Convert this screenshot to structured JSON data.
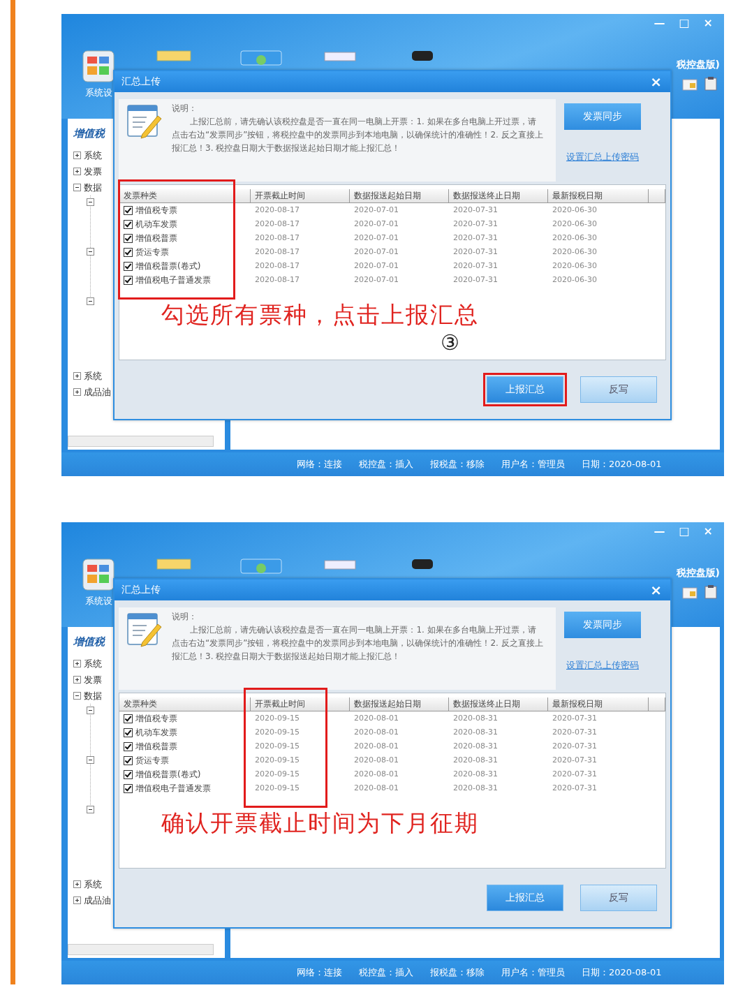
{
  "screens": [
    {
      "window": {
        "title_fragment": "税控盘版)",
        "controls": [
          "—",
          "□",
          "×"
        ],
        "toolbar_label": "系统设",
        "sidebar": {
          "title": "增值税",
          "items": [
            {
              "label": "系统",
              "expanded": false
            },
            {
              "label": "发票",
              "expanded": false
            },
            {
              "label": "数据",
              "expanded": true,
              "children": [
                {
                  "expanded": true
                },
                {
                  "expanded": true
                },
                {
                  "expanded": true
                }
              ]
            },
            {
              "label": "系统",
              "expanded": false
            },
            {
              "label": "成品油",
              "expanded": false
            }
          ]
        },
        "status_bar": [
          "网络：连接",
          "税控盘：插入",
          "报税盘：移除",
          "用户名：管理员",
          "日期：2020-08-01"
        ]
      },
      "dialog": {
        "title": "汇总上传",
        "close": "×",
        "note_label": "说明：",
        "note": "上报汇总前，请先确认该税控盘是否一直在同一电脑上开票：1. 如果在多台电脑上开过票，请点击右边“发票同步”按钮，将税控盘中的发票同步到本地电脑，以确保统计的准确性！2. 反之直接上报汇总！3. 税控盘日期大于数据报送起始日期才能上报汇总！",
        "sync_button": "发票同步",
        "password_link": "设置汇总上传密码",
        "table": {
          "columns": [
            {
              "label": "发票种类",
              "highlighted": true
            },
            {
              "label": "开票截止时间",
              "highlighted": false
            },
            {
              "label": "数据报送起始日期",
              "highlighted": false
            },
            {
              "label": "数据报送终止日期",
              "highlighted": false
            },
            {
              "label": "最新报税日期",
              "highlighted": false
            }
          ],
          "rows": [
            {
              "checked": true,
              "cells": [
                "增值税专票",
                "2020-08-17",
                "2020-07-01",
                "2020-07-31",
                "2020-06-30"
              ]
            },
            {
              "checked": true,
              "cells": [
                "机动车发票",
                "2020-08-17",
                "2020-07-01",
                "2020-07-31",
                "2020-06-30"
              ]
            },
            {
              "checked": true,
              "cells": [
                "增值税普票",
                "2020-08-17",
                "2020-07-01",
                "2020-07-31",
                "2020-06-30"
              ]
            },
            {
              "checked": true,
              "cells": [
                "货运专票",
                "2020-08-17",
                "2020-07-01",
                "2020-07-31",
                "2020-06-30"
              ]
            },
            {
              "checked": true,
              "cells": [
                "增值税普票(卷式)",
                "2020-08-17",
                "2020-07-01",
                "2020-07-31",
                "2020-06-30"
              ]
            },
            {
              "checked": true,
              "cells": [
                "增值税电子普通发票",
                "2020-08-17",
                "2020-07-01",
                "2020-07-31",
                "2020-06-30"
              ]
            }
          ]
        },
        "annotation": {
          "text": "勾选所有票种，点击上报汇总",
          "step": "③"
        },
        "buttons": [
          {
            "label": "上报汇总",
            "highlighted": true
          },
          {
            "label": "反写",
            "highlighted": false
          }
        ]
      }
    },
    {
      "window": {
        "title_fragment": "税控盘版)",
        "controls": [
          "—",
          "□",
          "×"
        ],
        "toolbar_label": "系统设",
        "sidebar": {
          "title": "增值税",
          "items": [
            {
              "label": "系统",
              "expanded": false
            },
            {
              "label": "发票",
              "expanded": false
            },
            {
              "label": "数据",
              "expanded": true,
              "children": [
                {
                  "expanded": true
                },
                {
                  "expanded": true
                },
                {
                  "expanded": true
                }
              ]
            },
            {
              "label": "系统",
              "expanded": false
            },
            {
              "label": "成品油",
              "expanded": false
            }
          ]
        },
        "status_bar": [
          "网络：连接",
          "税控盘：插入",
          "报税盘：移除",
          "用户名：管理员",
          "日期：2020-08-01"
        ]
      },
      "dialog": {
        "title": "汇总上传",
        "close": "×",
        "note_label": "说明：",
        "note": "上报汇总前，请先确认该税控盘是否一直在同一电脑上开票：1. 如果在多台电脑上开过票，请点击右边“发票同步”按钮，将税控盘中的发票同步到本地电脑，以确保统计的准确性！2. 反之直接上报汇总！3. 税控盘日期大于数据报送起始日期才能上报汇总！",
        "sync_button": "发票同步",
        "password_link": "设置汇总上传密码",
        "table": {
          "columns": [
            {
              "label": "发票种类",
              "highlighted": false
            },
            {
              "label": "开票截止时间",
              "highlighted": true
            },
            {
              "label": "数据报送起始日期",
              "highlighted": false
            },
            {
              "label": "数据报送终止日期",
              "highlighted": false
            },
            {
              "label": "最新报税日期",
              "highlighted": false
            }
          ],
          "rows": [
            {
              "checked": true,
              "cells": [
                "增值税专票",
                "2020-09-15",
                "2020-08-01",
                "2020-08-31",
                "2020-07-31"
              ]
            },
            {
              "checked": true,
              "cells": [
                "机动车发票",
                "2020-09-15",
                "2020-08-01",
                "2020-08-31",
                "2020-07-31"
              ]
            },
            {
              "checked": true,
              "cells": [
                "增值税普票",
                "2020-09-15",
                "2020-08-01",
                "2020-08-31",
                "2020-07-31"
              ]
            },
            {
              "checked": true,
              "cells": [
                "货运专票",
                "2020-09-15",
                "2020-08-01",
                "2020-08-31",
                "2020-07-31"
              ]
            },
            {
              "checked": true,
              "cells": [
                "增值税普票(卷式)",
                "2020-09-15",
                "2020-08-01",
                "2020-08-31",
                "2020-07-31"
              ]
            },
            {
              "checked": true,
              "cells": [
                "增值税电子普通发票",
                "2020-09-15",
                "2020-08-01",
                "2020-08-31",
                "2020-07-31"
              ]
            }
          ]
        },
        "annotation": {
          "text": "确认开票截止时间为下月征期"
        },
        "buttons": [
          {
            "label": "上报汇总",
            "highlighted": false
          },
          {
            "label": "反写",
            "highlighted": false
          }
        ]
      }
    }
  ]
}
